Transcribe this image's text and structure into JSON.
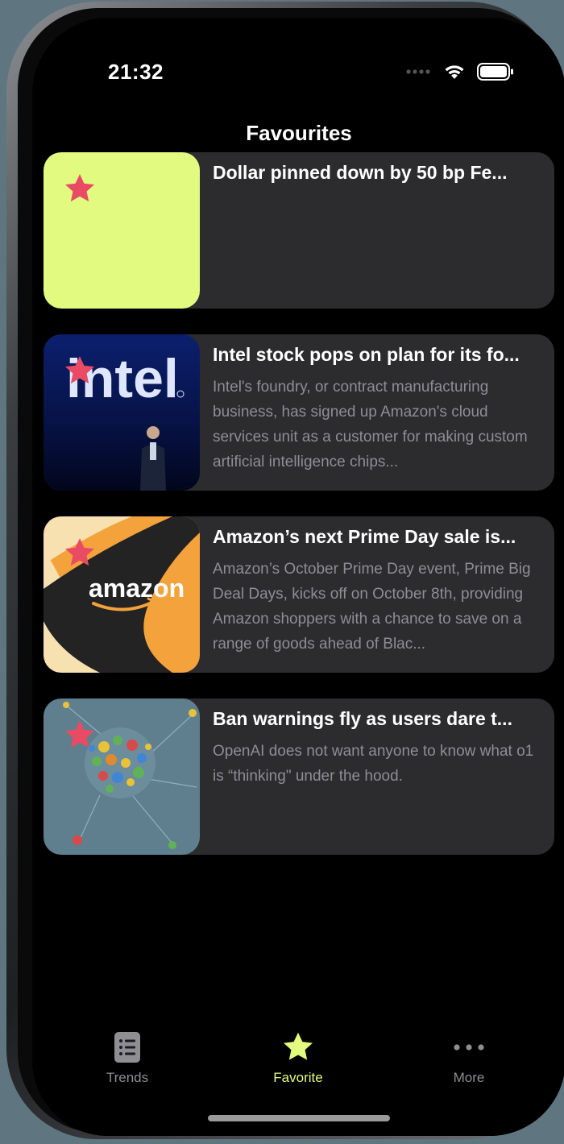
{
  "status": {
    "time": "21:32"
  },
  "header": {
    "title": "Favourites"
  },
  "articles": [
    {
      "title": "Dollar pinned down by 50 bp Fe...",
      "description": "",
      "image": "placeholder-image",
      "badge_icon": "star-icon"
    },
    {
      "title": "Intel stock pops on plan for its fo...",
      "description": "Intel's foundry, or contract manufacturing business, has signed up Amazon's cloud services unit as a customer for making custom artificial intelligence chips...",
      "image": "intel-logo-image",
      "badge_icon": "star-icon"
    },
    {
      "title": "Amazon’s next Prime Day sale is...",
      "description": "Amazon’s October Prime Day event, Prime Big Deal Days, kicks off on October 8th, providing Amazon shoppers with a chance to save on a range of goods ahead of Blac...",
      "image": "amazon-logo-image",
      "badge_icon": "star-icon"
    },
    {
      "title": "Ban warnings fly as users dare t...",
      "description": "OpenAI does not want anyone to know what o1 is “thinking\" under the hood.",
      "image": "ai-brain-gears-image",
      "badge_icon": "star-icon"
    }
  ],
  "tabbar": {
    "tabs": [
      {
        "label": "Trends",
        "icon": "list-icon",
        "selected": false
      },
      {
        "label": "Favorite",
        "icon": "star-icon",
        "selected": true
      },
      {
        "label": "More",
        "icon": "ellipsis-icon",
        "selected": false
      }
    ]
  },
  "colors": {
    "accent": "#e2fa7f",
    "star_badge": "#e94b64",
    "card_bg": "#2c2c2e",
    "tab_inactive": "#8e8e93",
    "placeholder_bg": "#e2fa7f"
  }
}
